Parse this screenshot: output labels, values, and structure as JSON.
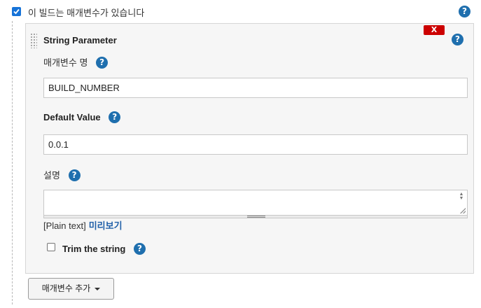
{
  "params_toggle": {
    "label": "이 빌드는 매개변수가 있습니다",
    "checked": true
  },
  "help_icon": "?",
  "parameter": {
    "delete_label": "X",
    "title": "String Parameter",
    "name_label": "매개변수 명",
    "name_value": "BUILD_NUMBER",
    "default_label": "Default Value",
    "default_value": "0.0.1",
    "description_label": "설명",
    "description_value": "",
    "plain_text": "[Plain text]",
    "preview_link": "미리보기",
    "trim_label": "Trim the string",
    "trim_checked": false
  },
  "add_button_label": "매개변수 추가"
}
